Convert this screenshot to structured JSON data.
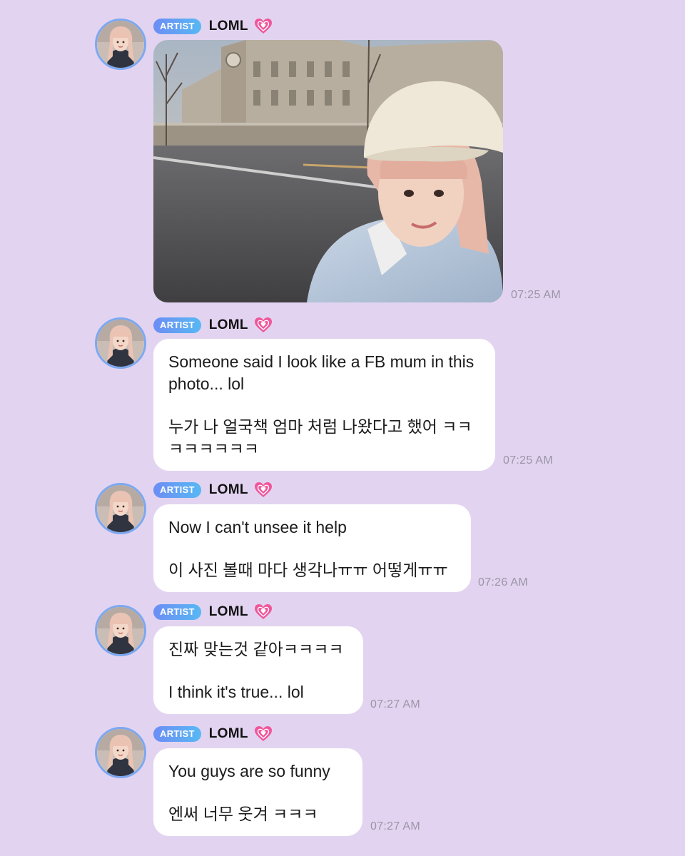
{
  "messages": [
    {
      "badge": "ARTIST",
      "name": "LOML",
      "type": "photo",
      "time": "07:25 AM"
    },
    {
      "badge": "ARTIST",
      "name": "LOML",
      "type": "text",
      "paragraphs": [
        "Someone said I look like a FB mum in this photo... lol",
        "누가 나 얼국책 엄마 처럼 나왔다고 했어 ㅋㅋㅋㅋㅋㅋㅋㅋ"
      ],
      "time": "07:25 AM"
    },
    {
      "badge": "ARTIST",
      "name": "LOML",
      "type": "text",
      "paragraphs": [
        "Now I can't unsee it help",
        "이 사진 볼때 마다 생각나ㅠㅠ 어떻게ㅠㅠ"
      ],
      "time": "07:26 AM"
    },
    {
      "badge": "ARTIST",
      "name": "LOML",
      "type": "text",
      "paragraphs": [
        "진짜 맞는것 같아ㅋㅋㅋㅋ",
        "I think it's true... lol"
      ],
      "time": "07:27 AM"
    },
    {
      "badge": "ARTIST",
      "name": "LOML",
      "type": "text",
      "paragraphs": [
        "You guys are so funny",
        "엔써 너무 웃겨 ㅋㅋㅋ"
      ],
      "time": "07:27 AM"
    }
  ],
  "colors": {
    "background": "#e2d4f1",
    "bubble": "#ffffff",
    "badge_start": "#6d8df5",
    "badge_end": "#57b8f3",
    "heart": "#f0569b",
    "avatar_ring": "#7da8f0",
    "timestamp": "#9a95a6"
  },
  "icons": {
    "heart": "growing-heart-icon",
    "avatar": "artist-avatar-photo"
  }
}
